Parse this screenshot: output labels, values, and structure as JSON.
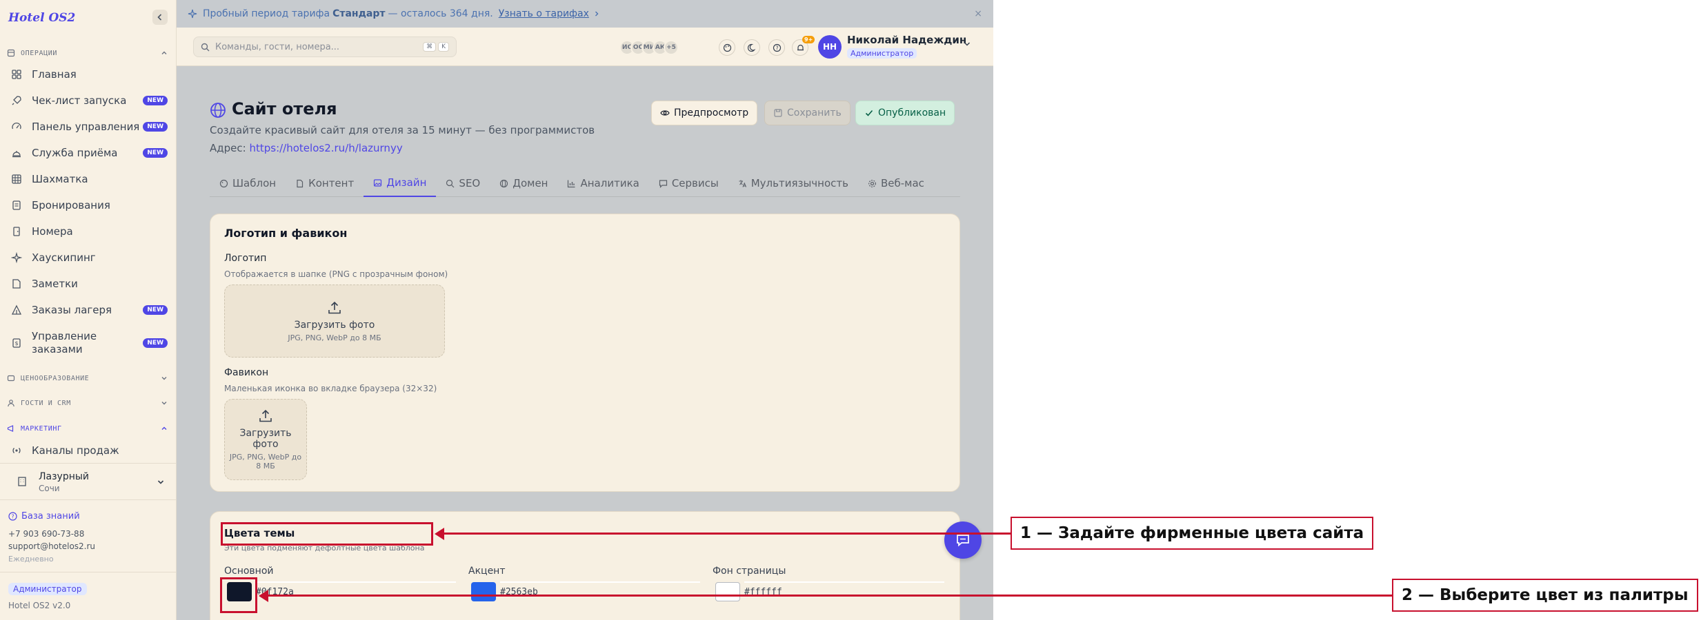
{
  "app": {
    "brand": "Hotel OS2"
  },
  "sidebar": {
    "sections": [
      {
        "label": "ОПЕРАЦИИ"
      },
      {
        "label": "ЦЕНООБРАЗОВАНИЕ"
      },
      {
        "label": "ГОСТИ И CRM"
      },
      {
        "label": "МАРКЕТИНГ"
      }
    ],
    "items": [
      {
        "label": "Главная",
        "icon": "dashboard-icon"
      },
      {
        "label": "Чек-лист запуска",
        "icon": "rocket-icon",
        "badge": "NEW"
      },
      {
        "label": "Панель управления",
        "icon": "gauge-icon",
        "badge": "NEW"
      },
      {
        "label": "Служба приёма",
        "icon": "bell-icon",
        "badge": "NEW"
      },
      {
        "label": "Шахматка",
        "icon": "grid-icon"
      },
      {
        "label": "Бронирования",
        "icon": "document-icon"
      },
      {
        "label": "Номера",
        "icon": "door-icon"
      },
      {
        "label": "Хаускипинг",
        "icon": "sparkles-icon"
      },
      {
        "label": "Заметки",
        "icon": "note-icon"
      },
      {
        "label": "Заказы лагеря",
        "icon": "tent-icon",
        "badge": "NEW"
      },
      {
        "label": "Управление заказами",
        "icon": "receipt-icon",
        "badge": "NEW"
      },
      {
        "label": "Каналы продаж",
        "icon": "radio-icon"
      }
    ],
    "hotel": {
      "name": "Лазурный",
      "city": "Сочи"
    },
    "knowledge_base": "База знаний",
    "phone": "+7 903 690-73-88",
    "email": "support@hotelos2.ru",
    "schedule": "Ежедневно",
    "role": "Администратор",
    "version": "Hotel OS2 v2.0"
  },
  "banner": {
    "prefix": "Пробный период тарифа",
    "plan": "Стандарт",
    "suffix": "— осталось 364 дня.",
    "link": "Узнать о тарифах",
    "close": "×"
  },
  "header": {
    "search_placeholder": "Команды, гости, номера...",
    "kbd_cmd": "⌘",
    "kbd_k": "K",
    "presence": [
      "ИС",
      "ОС",
      "МИ",
      "АК",
      "+5"
    ],
    "notifications": "9+",
    "user_initials": "НН",
    "user_name": "Николай Надеждин",
    "user_role": "Администратор"
  },
  "page": {
    "title": "Сайт отеля",
    "subtitle": "Создайте красивый сайт для отеля за 15 минут — без программистов",
    "address_label": "Адрес:",
    "address_url": "https://hotelos2.ru/h/lazurnyy",
    "btn_preview": "Предпросмотр",
    "btn_save": "Сохранить",
    "btn_published": "Опубликован"
  },
  "tabs": [
    {
      "label": "Шаблон",
      "icon": "palette-icon"
    },
    {
      "label": "Контент",
      "icon": "file-icon"
    },
    {
      "label": "Дизайн",
      "icon": "image-icon",
      "active": true
    },
    {
      "label": "SEO",
      "icon": "search-icon"
    },
    {
      "label": "Домен",
      "icon": "globe-icon"
    },
    {
      "label": "Аналитика",
      "icon": "chart-icon"
    },
    {
      "label": "Сервисы",
      "icon": "chat-icon"
    },
    {
      "label": "Мультиязычность",
      "icon": "languages-icon"
    },
    {
      "label": "Веб-мас",
      "icon": "gear-icon"
    }
  ],
  "logo_card": {
    "title": "Логотип и фавикон",
    "logo_label": "Логотип",
    "logo_help": "Отображается в шапке (PNG с прозрачным фоном)",
    "upload_text": "Загрузить фото",
    "upload_hint": "JPG, PNG, WebP до 8 МБ",
    "favicon_label": "Фавикон",
    "favicon_help": "Маленькая иконка во вкладке браузера (32×32)"
  },
  "colors_card": {
    "title": "Цвета темы",
    "help": "Эти цвета подменяют дефолтные цвета шаблона",
    "colors": [
      {
        "label": "Основной",
        "hex": "#0f172a"
      },
      {
        "label": "Акцент",
        "hex": "#2563eb"
      },
      {
        "label": "Фон страницы",
        "hex": "#ffffff"
      }
    ]
  },
  "annotations": [
    {
      "text": "1 — Задайте фирменные цвета сайта"
    },
    {
      "text": "2 — Выберите цвет из палитры"
    }
  ]
}
